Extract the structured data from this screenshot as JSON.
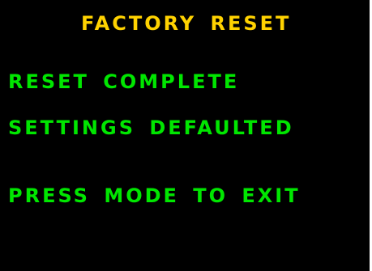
{
  "screen": {
    "title": "FACTORY RESET",
    "lines": [
      "RESET COMPLETE",
      "SETTINGS DEFAULTED",
      "PRESS MODE TO EXIT"
    ],
    "colors": {
      "background": "#000000",
      "title": "#ffd200",
      "text": "#00e600"
    }
  }
}
